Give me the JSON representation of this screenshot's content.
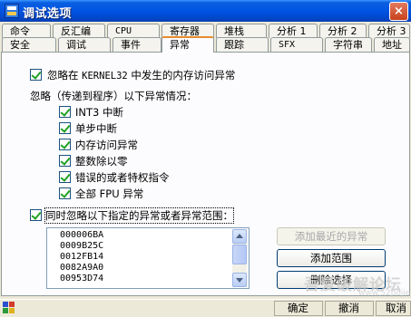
{
  "window": {
    "title": "调试选项",
    "close_label": "×"
  },
  "tabs": {
    "row1": [
      "命令",
      "反汇编",
      "CPU",
      "寄存器",
      "堆栈",
      "分析 1",
      "分析 2",
      "分析 3"
    ],
    "row2": [
      "安全",
      "调试",
      "事件",
      "异常",
      "跟踪",
      "SFX",
      "字符串",
      "地址"
    ],
    "active": "异常"
  },
  "exceptions": {
    "ignore_kernel_pre": "忽略在",
    "ignore_kernel_mono": "KERNEL32",
    "ignore_kernel_post": "中发生的内存访问异常",
    "ignore_kernel_checked": true,
    "group_label": "忽略（传递到程序）以下异常情况：",
    "items": [
      {
        "label": "INT3 中断",
        "checked": true
      },
      {
        "label": "单步中断",
        "checked": true
      },
      {
        "label": "内存访问异常",
        "checked": true
      },
      {
        "label": "整数除以零",
        "checked": true
      },
      {
        "label": "错误的或者特权指令",
        "checked": true
      },
      {
        "label": "全部 FPU 异常",
        "checked": true
      }
    ],
    "range_label": "同时忽略以下指定的异常或者异常范围：",
    "range_checked": true,
    "range_list": [
      "000006BA",
      "0009B25C",
      "0012FB14",
      "0082A9A0",
      "00953D74"
    ]
  },
  "buttons": {
    "add_last": "添加最近的异常",
    "add_range": "添加范围",
    "delete_selected": "删除选择"
  },
  "statusbar": {
    "ok": "确定",
    "undo": "撤消",
    "cancel": "取消"
  },
  "watermark": {
    "text": "吾爱破解论坛",
    "url": "www.52pojie.cn"
  },
  "colors": {
    "title_bar": "#0054e3",
    "active_tab_accent": "#e68b2c",
    "check_mark": "#21a121",
    "dialog_bg": "#ece9d8"
  }
}
